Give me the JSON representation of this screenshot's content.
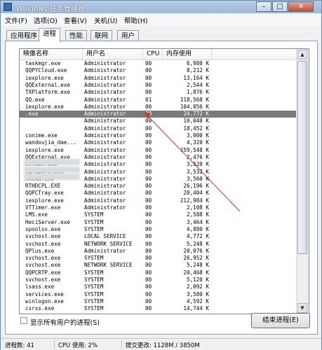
{
  "window": {
    "title": "Windows 任务管理器",
    "min": "–",
    "max": "□",
    "close": "✕"
  },
  "menu": [
    "文件(F)",
    "选项(O)",
    "查看(V)",
    "关机(U)",
    "帮助(H)"
  ],
  "tabs": [
    "应用程序",
    "进程",
    "性能",
    "联网",
    "用户"
  ],
  "active_tab": "进程",
  "columns": {
    "name": "映像名称",
    "user": "用户名",
    "cpu": "CPU",
    "mem": "内存使用"
  },
  "rows": [
    {
      "name": "taskmgr.exe",
      "user": "Administrator",
      "cpu": "00",
      "mem": "6,980 K"
    },
    {
      "name": "QQPYCloud.exe",
      "user": "Administrator",
      "cpu": "00",
      "mem": "8,212 K"
    },
    {
      "name": "iexplore.exe",
      "user": "Administrator",
      "cpu": "00",
      "mem": "13,164 K"
    },
    {
      "name": "QQExternal.exe",
      "user": "Administrator",
      "cpu": "00",
      "mem": "2,544 K"
    },
    {
      "name": "TXPlatform.exe",
      "user": "Administrator",
      "cpu": "00",
      "mem": "1,876 K"
    },
    {
      "name": "QQ.exe",
      "user": "Administrator",
      "cpu": "01",
      "mem": "118,568 K"
    },
    {
      "name": "iexplore.exe",
      "user": "Administrator",
      "cpu": "00",
      "mem": "104,056 K"
    },
    {
      "name": ".exe",
      "user": "Administrator",
      "cpu": "00",
      "mem": "24,772 K",
      "selected": true
    },
    {
      "name": "",
      "user": "Administrator",
      "cpu": "00",
      "mem": "10,040 K"
    },
    {
      "name": "",
      "user": "Administrator",
      "cpu": "00",
      "mem": "18,452 K"
    },
    {
      "name": "conime.exe",
      "user": "Administrator",
      "cpu": "00",
      "mem": "3,000 K"
    },
    {
      "name": "wandoujia_dae...",
      "user": "Administrator",
      "cpu": "00",
      "mem": "4,320 K"
    },
    {
      "name": "iexplore.exe",
      "user": "Administrator",
      "cpu": "00",
      "mem": "159,548 K"
    },
    {
      "name": "QQExternal.exe",
      "user": "Administrator",
      "cpu": "00",
      "mem": "2,476 K"
    },
    {
      "name": "ctfmon.exe",
      "user": "Administrator",
      "cpu": "00",
      "mem": "3,520 K"
    },
    {
      "name": "igfxpers.exe",
      "user": "Administrator",
      "cpu": "00",
      "mem": "3,532 K"
    },
    {
      "name": "hkcmd.exe",
      "user": "Administrator",
      "cpu": "00",
      "mem": "3,560 K"
    },
    {
      "name": "RTHDCPL.EXE",
      "user": "Administrator",
      "cpu": "00",
      "mem": "26,196 K"
    },
    {
      "name": "QQPCTray.exe",
      "user": "Administrator",
      "cpu": "00",
      "mem": "20,404 K"
    },
    {
      "name": "iexplore.exe",
      "user": "Administrator",
      "cpu": "00",
      "mem": "212,984 K"
    },
    {
      "name": "VTTimer.exe",
      "user": "Administrator",
      "cpu": "00",
      "mem": "2,108 K"
    },
    {
      "name": "LMS.exe",
      "user": "SYSTEM",
      "cpu": "00",
      "mem": "2,588 K"
    },
    {
      "name": "HeciServer.exe",
      "user": "SYSTEM",
      "cpu": "00",
      "mem": "3,464 K"
    },
    {
      "name": "spoolsv.exe",
      "user": "SYSTEM",
      "cpu": "00",
      "mem": "4,880 K"
    },
    {
      "name": "svchost.exe",
      "user": "LOCAL SERVICE",
      "cpu": "00",
      "mem": "4,772 K"
    },
    {
      "name": "svchost.exe",
      "user": "NETWORK SERVICE",
      "cpu": "00",
      "mem": "5,248 K"
    },
    {
      "name": "QPlus.exe",
      "user": "Administrator",
      "cpu": "00",
      "mem": "20,076 K"
    },
    {
      "name": "svchost.exe",
      "user": "SYSTEM",
      "cpu": "00",
      "mem": "26,952 K"
    },
    {
      "name": "svchost.exe",
      "user": "NETWORK SERVICE",
      "cpu": "00",
      "mem": "5,248 K"
    },
    {
      "name": "QQPCRTP.exe",
      "user": "SYSTEM",
      "cpu": "00",
      "mem": "20,468 K"
    },
    {
      "name": "svchost.exe",
      "user": "SYSTEM",
      "cpu": "00",
      "mem": "5,120 K"
    },
    {
      "name": "lsass.exe",
      "user": "SYSTEM",
      "cpu": "00",
      "mem": "2,092 K"
    },
    {
      "name": "services.exe",
      "user": "SYSTEM",
      "cpu": "00",
      "mem": "3,580 K"
    },
    {
      "name": "winlogon.exe",
      "user": "SYSTEM",
      "cpu": "00",
      "mem": "4,592 K"
    },
    {
      "name": "csrss.exe",
      "user": "SYSTEM",
      "cpu": "00",
      "mem": "14,744 K"
    }
  ],
  "show_all_label": "显示所有用户的进程(S)",
  "end_process_label": "结束进程(E)",
  "status": {
    "procs": "进程数: 41",
    "cpu": "CPU 使用: 2%",
    "commit": "提交更改: 1128M / 3850M"
  }
}
